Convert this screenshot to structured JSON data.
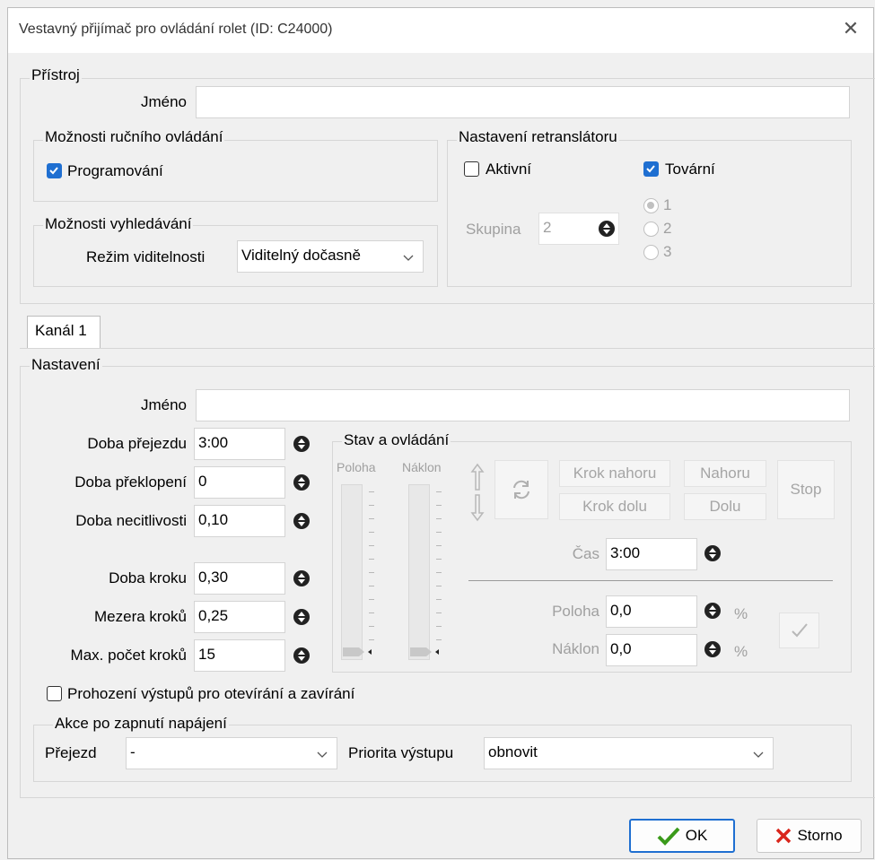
{
  "window": {
    "title": "Vestavný přijímač pro ovládání rolet (ID: C24000)",
    "close_glyph": "✕"
  },
  "device": {
    "group_label": "Přístroj",
    "name_label": "Jméno",
    "name_value": "",
    "manual": {
      "group_label": "Možnosti ručního ovládání",
      "programming_label": "Programování",
      "programming_checked": true
    },
    "search": {
      "group_label": "Možnosti vyhledávání",
      "visibility_label": "Režim viditelnosti",
      "visibility_value": "Viditelný dočasně"
    },
    "repeater": {
      "group_label": "Nastavení retranslátoru",
      "active_label": "Aktivní",
      "active_checked": false,
      "factory_label": "Tovární",
      "factory_checked": true,
      "group_field_label": "Skupina",
      "group_field_value": "2",
      "radios": [
        "1",
        "2",
        "3"
      ],
      "radio_selected": "1"
    }
  },
  "tabs": [
    "Kanál 1"
  ],
  "settings": {
    "group_label": "Nastavení",
    "name_label": "Jméno",
    "name_value": "",
    "travel_time_label": "Doba přejezdu",
    "travel_time_value": "3:00",
    "tilt_time_label": "Doba překlopení",
    "tilt_time_value": "0",
    "insensitivity_label": "Doba necitlivosti",
    "insensitivity_value": "0,10",
    "step_time_label": "Doba kroku",
    "step_time_value": "0,30",
    "step_gap_label": "Mezera kroků",
    "step_gap_value": "0,25",
    "max_steps_label": "Max. počet kroků",
    "max_steps_value": "15",
    "swap_outputs_label": "Prohození výstupů pro otevírání a zavírání",
    "swap_outputs_checked": false
  },
  "control": {
    "group_label": "Stav a ovládání",
    "position_slider_label": "Poloha",
    "tilt_slider_label": "Náklon",
    "step_up": "Krok nahoru",
    "up": "Nahoru",
    "step_down": "Krok dolu",
    "down": "Dolu",
    "stop": "Stop",
    "time_label": "Čas",
    "time_value": "3:00",
    "position_label": "Poloha",
    "position_value": "0,0",
    "position_unit": "%",
    "tilt_label": "Náklon",
    "tilt_value": "0,0",
    "tilt_unit": "%"
  },
  "poweron": {
    "group_label": "Akce po zapnutí napájení",
    "travel_label": "Přejezd",
    "travel_value": "-",
    "priority_label": "Priorita výstupu",
    "priority_value": "obnovit"
  },
  "footer": {
    "ok_label": "OK",
    "cancel_label": "Storno"
  },
  "colors": {
    "accent": "#1f6fd1",
    "ok_border": "#1f6fd1",
    "cancel_x": "#d9261c",
    "ok_check": "#3a9a1a"
  }
}
